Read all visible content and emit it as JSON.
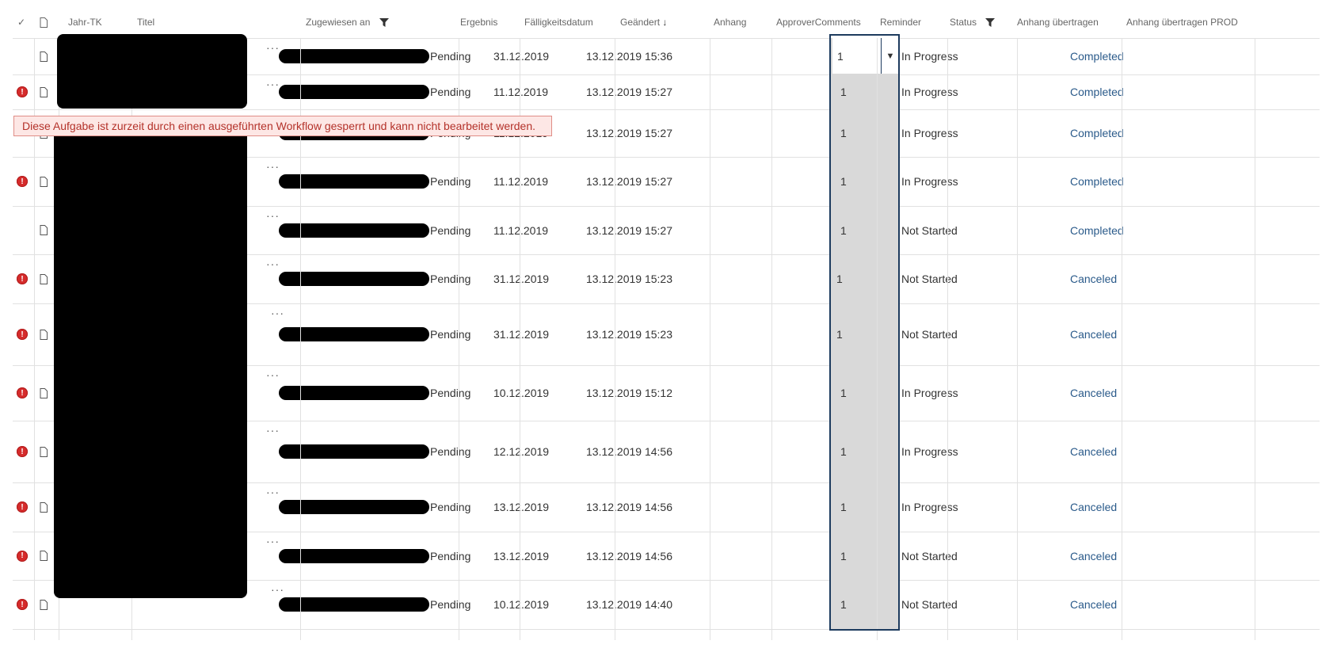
{
  "header": {
    "check_symbol": "✓",
    "columns": {
      "jahr": "Jahr-TK",
      "titel": "Titel",
      "zugewiesen": "Zugewiesen an",
      "ergebnis": "Ergebnis",
      "faellig": "Fälligkeitsdatum",
      "geaendert": "Geändert",
      "anhang": "Anhang",
      "approver": "ApproverComments",
      "reminder": "Reminder",
      "status": "Status",
      "anhang_uebertragen": "Anhang übertragen",
      "anhang_uebertragen_prod": "Anhang übertragen PROD"
    },
    "sort_arrow": "↓"
  },
  "tooltip": "Diese Aufgabe ist zurzeit durch einen ausgeführten Workflow gesperrt und kann nicht bearbeitet werden.",
  "more_symbol": "···",
  "rows": [
    {
      "ergebnis": "Pending",
      "faellig": "31.12.2019",
      "geaendert": "13.12.2019 15:36",
      "reminder": "1",
      "status": "In Progress",
      "prod": "Completed",
      "error": false
    },
    {
      "ergebnis": "Pending",
      "faellig": "11.12.2019",
      "geaendert": "13.12.2019 15:27",
      "reminder": "1",
      "status": "In Progress",
      "prod": "Completed",
      "error": true
    },
    {
      "ergebnis": "Pending",
      "faellig": "11.12.2019",
      "geaendert": "13.12.2019 15:27",
      "reminder": "1",
      "status": "In Progress",
      "prod": "Completed",
      "error": false
    },
    {
      "ergebnis": "Pending",
      "faellig": "11.12.2019",
      "geaendert": "13.12.2019 15:27",
      "reminder": "1",
      "status": "In Progress",
      "prod": "Completed",
      "error": true
    },
    {
      "ergebnis": "Pending",
      "faellig": "11.12.2019",
      "geaendert": "13.12.2019 15:27",
      "reminder": "1",
      "status": "Not Started",
      "prod": "Completed",
      "error": false
    },
    {
      "ergebnis": "Pending",
      "faellig": "31.12.2019",
      "geaendert": "13.12.2019 15:23",
      "reminder": "1",
      "status": "Not Started",
      "prod": "Canceled",
      "error": true
    },
    {
      "ergebnis": "Pending",
      "faellig": "31.12.2019",
      "geaendert": "13.12.2019 15:23",
      "reminder": "1",
      "status": "Not Started",
      "prod": "Canceled",
      "error": true
    },
    {
      "ergebnis": "Pending",
      "faellig": "10.12.2019",
      "geaendert": "13.12.2019 15:12",
      "reminder": "1",
      "status": "In Progress",
      "prod": "Canceled",
      "error": true
    },
    {
      "ergebnis": "Pending",
      "faellig": "12.12.2019",
      "geaendert": "13.12.2019 14:56",
      "reminder": "1",
      "status": "In Progress",
      "prod": "Canceled",
      "error": true
    },
    {
      "ergebnis": "Pending",
      "faellig": "13.12.2019",
      "geaendert": "13.12.2019 14:56",
      "reminder": "1",
      "status": "In Progress",
      "prod": "Canceled",
      "error": true
    },
    {
      "ergebnis": "Pending",
      "faellig": "13.12.2019",
      "geaendert": "13.12.2019 14:56",
      "reminder": "1",
      "status": "Not Started",
      "prod": "Canceled",
      "error": true
    },
    {
      "ergebnis": "Pending",
      "faellig": "10.12.2019",
      "geaendert": "13.12.2019 14:40",
      "reminder": "1",
      "status": "Not Started",
      "prod": "Canceled",
      "error": true
    }
  ],
  "reminder_dropdown_arrow": "▼",
  "error_symbol": "!",
  "colors": {
    "error": "#d52b2b",
    "link": "#2a5a8a",
    "selection_border": "#1d3b5e",
    "tooltip_bg": "#fde7e5",
    "tooltip_text": "#b4322a"
  }
}
